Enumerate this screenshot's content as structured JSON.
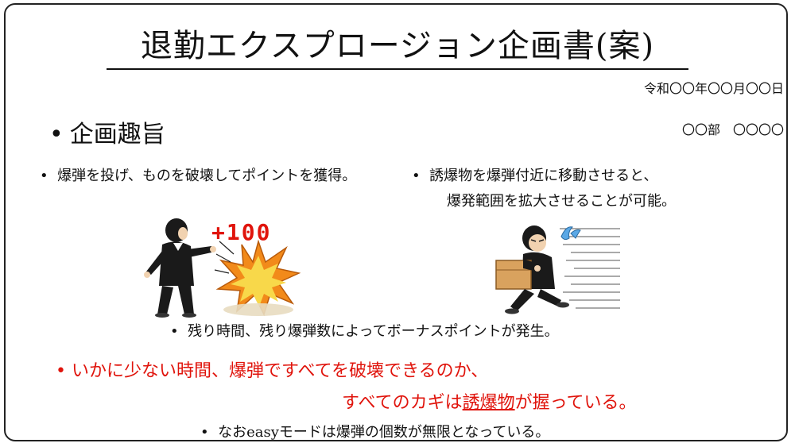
{
  "title": "退勤エクスプロージョン企画書(案)",
  "date": "令和〇〇年〇〇月〇〇日",
  "department": "〇〇部　〇〇〇〇",
  "section_heading": "企画趣旨",
  "bullet_dot": "•",
  "bullets": {
    "b1": "爆弾を投げ、ものを破壊してポイントを獲得。",
    "b2_line1": "誘爆物を爆弾付近に移動させると、",
    "b2_line2": "爆発範囲を拡大させることが可能。",
    "b3": "残り時間、残り爆弾数によってボーナスポイントが発生。",
    "b4": "なおeasyモードは爆弾の個数が無限となっている。"
  },
  "highlight": {
    "line1": "いかに少ない時間、爆弾ですべてを破壊できるのか、",
    "line2_pre": "すべてのカギは",
    "line2_key": "誘爆物",
    "line2_post": "が握っている。"
  },
  "illustration": {
    "score_text": "+100"
  },
  "colors": {
    "highlight_red": "#e0140c",
    "explosion_orange": "#f28a1a",
    "explosion_yellow": "#f8d84a",
    "box_tan": "#d9a25e",
    "suit_black": "#1a1a1a"
  },
  "icons": [
    "man-throwing-icon",
    "explosion-icon",
    "man-carrying-box-icon",
    "sweat-drop-icon",
    "speed-lines-icon"
  ]
}
